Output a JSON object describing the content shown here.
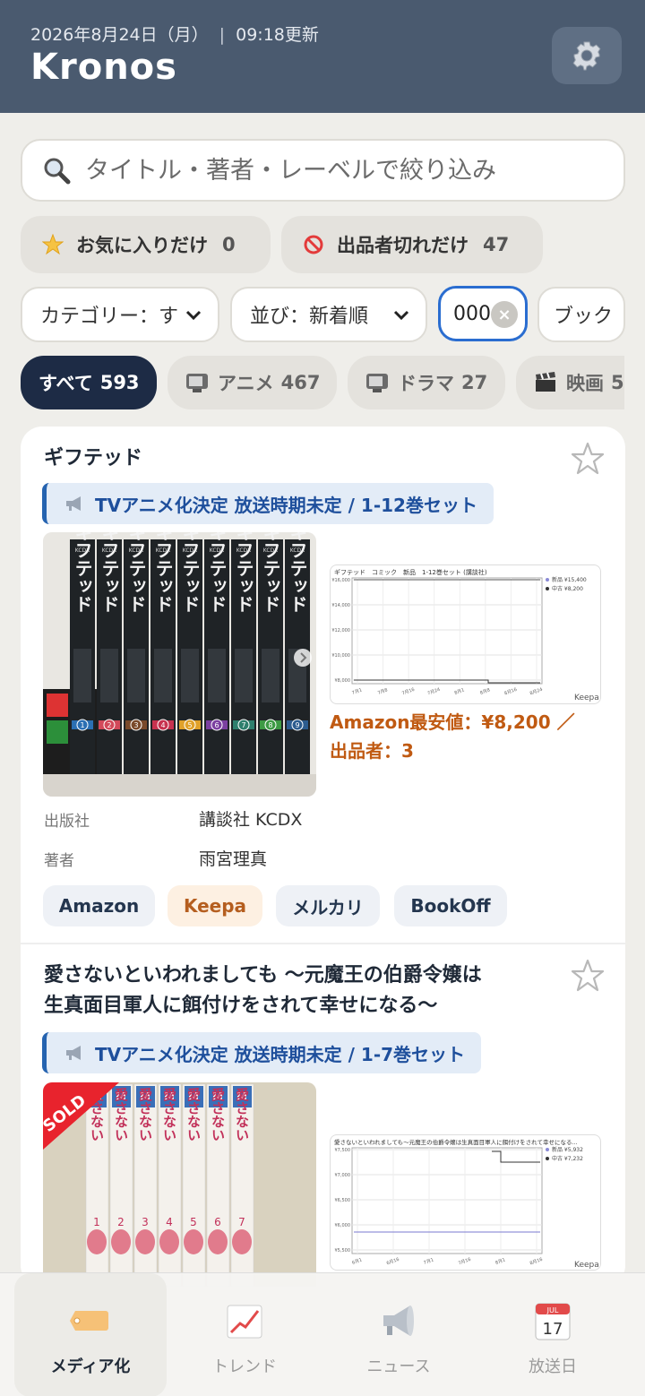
{
  "header": {
    "date": "2026年8月24日（月）",
    "updated": "09:18更新",
    "title": "Kronos",
    "settings_icon": "gear-icon"
  },
  "search": {
    "placeholder": "タイトル・著者・レーベルで絞り込み"
  },
  "filters": {
    "favorites": {
      "label": "お気に入りだけ",
      "count": "0"
    },
    "out_of_stock": {
      "label": "出品者切れだけ",
      "count": "47"
    }
  },
  "controls": {
    "category_select": "カテゴリー：す",
    "sort_select": "並び：新着順",
    "year_value": "000",
    "bookmark": "ブック"
  },
  "categories": [
    {
      "label": "すべて",
      "count": "593"
    },
    {
      "label": "アニメ",
      "count": "467"
    },
    {
      "label": "ドラマ",
      "count": "27"
    },
    {
      "label": "映画",
      "count": "5"
    }
  ],
  "items": [
    {
      "title": "ギフテッド",
      "media_tag": "TVアニメ化決定 放送時期未定 / 1-12巻セット",
      "keepa_title": "ギフテッド　コミック　新品　1-12巻セット (講談社)",
      "keepa_legend": [
        "新品 ¥15,400",
        "中古 ¥8,200"
      ],
      "keepa_yticks": [
        "¥16,000",
        "¥14,000",
        "¥12,000",
        "¥10,000",
        "¥8,000"
      ],
      "keepa_xticks": [
        "7月1",
        "7月8",
        "7月16",
        "7月24",
        "8月1",
        "8月8",
        "8月16",
        "8月24"
      ],
      "price_line1": "Amazon最安値：¥8,200 ／",
      "price_line2": "出品者：3",
      "publisher_label": "出版社",
      "publisher": "講談社 KCDX",
      "author_label": "著者",
      "author": "雨宮理真",
      "links": [
        "Amazon",
        "Keepa",
        "メルカリ",
        "BookOff"
      ],
      "spine_label": "KCDX",
      "spine_title": "ギフテッド",
      "volumes": [
        "1",
        "2",
        "3",
        "4",
        "5",
        "6",
        "7",
        "8",
        "9"
      ]
    },
    {
      "title_line1": "愛さないといわれましても 〜元魔王の伯爵令嬢は",
      "title_line2": "生真面目軍人に餌付けをされて幸せになる〜",
      "media_tag": "TVアニメ化決定 放送時期未定 / 1-7巻セット",
      "sold_label": "SOLD",
      "keepa_title": "愛さないといわれましても〜元魔王の伯爵令嬢は生真面目軍人に餌付けをされて幸せになる...",
      "keepa_legend": [
        "新品 ¥5,932",
        "中古 ¥7,232"
      ],
      "keepa_yticks": [
        "¥7,500",
        "¥7,000",
        "¥6,500",
        "¥6,000",
        "¥5,500"
      ],
      "keepa_xticks": [
        "6月1",
        "6月16",
        "7月1",
        "7月16",
        "8月1",
        "8月16"
      ],
      "spine_label": "M",
      "spine_title": "愛さない",
      "volumes": [
        "1",
        "2",
        "3",
        "4",
        "5",
        "6",
        "7"
      ]
    }
  ],
  "keepa_brand": "Keepa",
  "nav": [
    {
      "label": "メディア化",
      "icon": "tag-icon"
    },
    {
      "label": "トレンド",
      "icon": "trend-chart-icon"
    },
    {
      "label": "ニュース",
      "icon": "megaphone-icon"
    },
    {
      "label": "放送日",
      "icon": "calendar-icon"
    }
  ],
  "calendar_day": "17",
  "calendar_month": "JUL",
  "colors": {
    "header_bg": "#4a5a6f",
    "accent_blue": "#2a6dd0",
    "price_orange": "#c05a12",
    "active_chip": "#1d2b45"
  }
}
